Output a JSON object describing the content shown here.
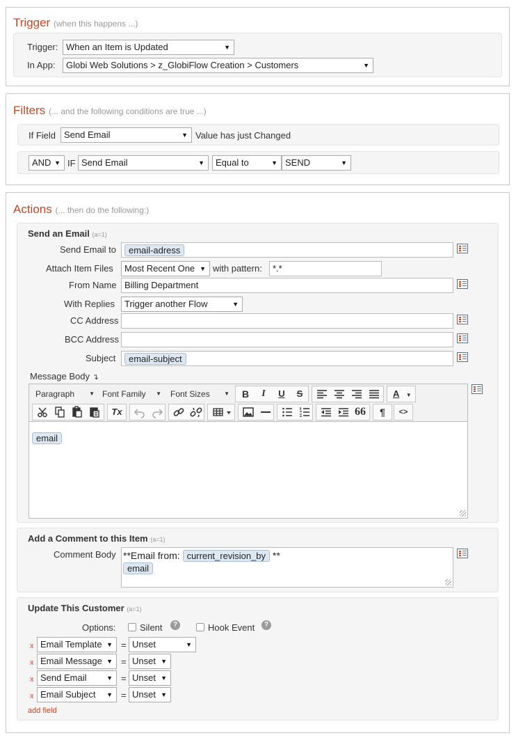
{
  "trigger": {
    "title": "Trigger",
    "subtitle": "(when this happens ...)",
    "trigger_label": "Trigger:",
    "trigger_value": "When an Item is Updated",
    "app_label": "In App:",
    "app_value": "Globi Web Solutions > z_GlobiFlow Creation > Customers"
  },
  "filters": {
    "title": "Filters",
    "subtitle": "(... and the following conditions are true ...)",
    "if_field_label": "If Field",
    "field_value": "Send Email",
    "changed_text": "Value has just Changed",
    "op_value": "AND",
    "if_label": "IF",
    "cond_field": "Send Email",
    "cond_op": "Equal to",
    "cond_value": "SEND"
  },
  "actions": {
    "title": "Actions",
    "subtitle": "(... then do the following:)",
    "send_email": {
      "title": "Send an Email",
      "note": "(a=1)",
      "to_label": "Send Email to",
      "to_token": "email-adress",
      "attach_label": "Attach Item Files",
      "attach_value": "Most Recent One",
      "pattern_label": "with pattern:",
      "pattern_value": "*.*",
      "from_label": "From Name",
      "from_value": "Billing Department",
      "replies_label": "With Replies",
      "replies_value": "Trigger another Flow",
      "cc_label": "CC Address",
      "bcc_label": "BCC Address",
      "subject_label": "Subject",
      "subject_token": "email-subject",
      "body_label": "Message Body",
      "body_arrow": "↴",
      "body_token": "email",
      "toolbar": {
        "paragraph": "Paragraph",
        "font_family": "Font Family",
        "font_sizes": "Font Sizes",
        "bold": "B",
        "italic": "I",
        "underline": "U",
        "strike": "S",
        "font_color": "A",
        "clear_format": "Tx",
        "blockquote": "66",
        "pilcrow": "¶",
        "code": "<>"
      }
    },
    "comment": {
      "title": "Add a Comment to this Item",
      "note": "(a=1)",
      "label": "Comment Body",
      "prefix": "**Email from:",
      "token1": "current_revision_by",
      "suffix": "**",
      "token2": "email"
    },
    "update": {
      "title": "Update This Customer",
      "note": "(a=1)",
      "options_label": "Options:",
      "silent_label": "Silent",
      "hook_label": "Hook Event",
      "help": "?",
      "remove": "x",
      "equals": "=",
      "rows": [
        {
          "field": "Email Template",
          "value": "Unset"
        },
        {
          "field": "Email Message",
          "value": "Unset"
        },
        {
          "field": "Send Email",
          "value": "Unset"
        },
        {
          "field": "Email Subject",
          "value": "Unset"
        }
      ],
      "add_field": "add field"
    }
  }
}
